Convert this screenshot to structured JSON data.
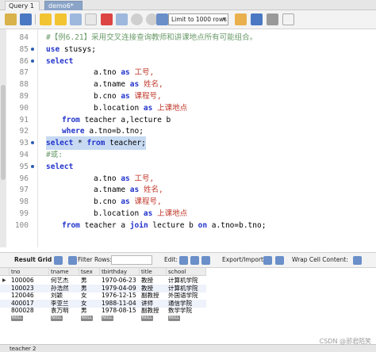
{
  "tabs": [
    {
      "label": "Query 1"
    },
    {
      "label": "demo6*"
    }
  ],
  "toolbar": {
    "limit": "Limit to 1000 rows"
  },
  "editor": {
    "lines": [
      {
        "num": "84",
        "dot": false,
        "indent": 0,
        "tokens": [
          {
            "t": "#【例6.21】采用交叉连接查询教师和讲课地点所有可能组合。",
            "c": "cmt"
          }
        ]
      },
      {
        "num": "85",
        "dot": true,
        "indent": 0,
        "tokens": [
          {
            "t": "use",
            "c": "kw"
          },
          {
            "t": " stusys;",
            "c": ""
          }
        ]
      },
      {
        "num": "86",
        "dot": true,
        "indent": 0,
        "tokens": [
          {
            "t": "select",
            "c": "kw"
          }
        ]
      },
      {
        "num": "87",
        "dot": false,
        "indent": 3,
        "tokens": [
          {
            "t": "a.tno ",
            "c": ""
          },
          {
            "t": "as",
            "c": "kw"
          },
          {
            "t": " 工号,",
            "c": "cn"
          }
        ]
      },
      {
        "num": "88",
        "dot": false,
        "indent": 3,
        "tokens": [
          {
            "t": "a.tname ",
            "c": ""
          },
          {
            "t": "as",
            "c": "kw"
          },
          {
            "t": " 姓名,",
            "c": "cn"
          }
        ]
      },
      {
        "num": "89",
        "dot": false,
        "indent": 3,
        "tokens": [
          {
            "t": "b.cno ",
            "c": ""
          },
          {
            "t": "as",
            "c": "kw"
          },
          {
            "t": " 课程号,",
            "c": "cn"
          }
        ]
      },
      {
        "num": "90",
        "dot": false,
        "indent": 3,
        "tokens": [
          {
            "t": "b.location ",
            "c": ""
          },
          {
            "t": "as",
            "c": "kw"
          },
          {
            "t": " 上课地点",
            "c": "cn"
          }
        ]
      },
      {
        "num": "91",
        "dot": false,
        "indent": 1,
        "tokens": [
          {
            "t": "from",
            "c": "kw"
          },
          {
            "t": " teacher a,lecture b",
            "c": ""
          }
        ]
      },
      {
        "num": "92",
        "dot": false,
        "indent": 1,
        "tokens": [
          {
            "t": "where",
            "c": "kw"
          },
          {
            "t": " a.tno=b.tno;",
            "c": ""
          }
        ]
      },
      {
        "num": "93",
        "dot": true,
        "indent": 0,
        "highlight": true,
        "tokens": [
          {
            "t": "select",
            "c": "kw"
          },
          {
            "t": " * ",
            "c": ""
          },
          {
            "t": "from",
            "c": "kw"
          },
          {
            "t": " teacher;",
            "c": ""
          }
        ]
      },
      {
        "num": "94",
        "dot": false,
        "indent": 0,
        "tokens": [
          {
            "t": "#或:",
            "c": "cmt"
          }
        ]
      },
      {
        "num": "95",
        "dot": true,
        "indent": 0,
        "tokens": [
          {
            "t": "select",
            "c": "kw"
          }
        ]
      },
      {
        "num": "96",
        "dot": false,
        "indent": 3,
        "tokens": [
          {
            "t": "a.tno ",
            "c": ""
          },
          {
            "t": "as",
            "c": "kw"
          },
          {
            "t": " 工号,",
            "c": "cn"
          }
        ]
      },
      {
        "num": "97",
        "dot": false,
        "indent": 3,
        "tokens": [
          {
            "t": "a.tname ",
            "c": ""
          },
          {
            "t": "as",
            "c": "kw"
          },
          {
            "t": " 姓名,",
            "c": "cn"
          }
        ]
      },
      {
        "num": "98",
        "dot": false,
        "indent": 3,
        "tokens": [
          {
            "t": "b.cno ",
            "c": ""
          },
          {
            "t": "as",
            "c": "kw"
          },
          {
            "t": " 课程号,",
            "c": "cn"
          }
        ]
      },
      {
        "num": "99",
        "dot": false,
        "indent": 3,
        "tokens": [
          {
            "t": "b.location ",
            "c": ""
          },
          {
            "t": "as",
            "c": "kw"
          },
          {
            "t": " 上课地点",
            "c": "cn"
          }
        ]
      },
      {
        "num": "100",
        "dot": false,
        "indent": 1,
        "tokens": [
          {
            "t": "from",
            "c": "kw"
          },
          {
            "t": " teacher a ",
            "c": ""
          },
          {
            "t": "join",
            "c": "kw"
          },
          {
            "t": " lecture b ",
            "c": ""
          },
          {
            "t": "on",
            "c": "kw"
          },
          {
            "t": " a.tno=b.tno;",
            "c": ""
          }
        ]
      }
    ]
  },
  "results": {
    "grid_label": "Result Grid",
    "filter_label": "Filter Rows:",
    "edit_label": "Edit:",
    "export_label": "Export/Import:",
    "wrap_label": "Wrap Cell Content:",
    "columns": [
      "tno",
      "tname",
      "tsex",
      "tbirthday",
      "title",
      "school"
    ],
    "rows": [
      [
        "100006",
        "何艺杰",
        "男",
        "1970-06-23",
        "教授",
        "计算机学院"
      ],
      [
        "100023",
        "孙浩然",
        "男",
        "1979-04-09",
        "教授",
        "计算机学院"
      ],
      [
        "120046",
        "刘颖",
        "女",
        "1976-12-15",
        "副教授",
        "外国语学院"
      ],
      [
        "400017",
        "李亚兰",
        "女",
        "1988-11-04",
        "讲师",
        "通信学院"
      ],
      [
        "800028",
        "袁万明",
        "男",
        "1978-08-15",
        "副教授",
        "数学学院"
      ]
    ],
    "null_label": "NULL"
  },
  "bottom": {
    "tab_label": "teacher 2",
    "watermark": "CSDN @邪君陌笑"
  }
}
